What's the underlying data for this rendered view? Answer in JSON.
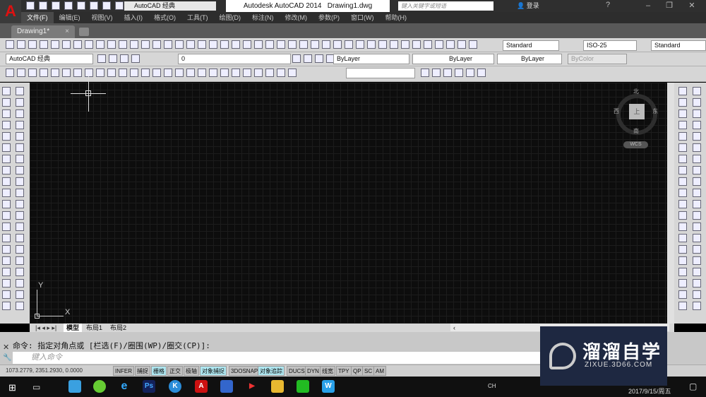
{
  "titlebar": {
    "app_title": "Autodesk AutoCAD 2014",
    "file": "Drawing1.dwg",
    "workspace": "AutoCAD 经典",
    "search_placeholder": "键入关键字或短语",
    "login": "登录"
  },
  "menu": [
    "文件(F)",
    "编辑(E)",
    "视图(V)",
    "插入(I)",
    "格式(O)",
    "工具(T)",
    "绘图(D)",
    "标注(N)",
    "修改(M)",
    "参数(P)",
    "窗口(W)",
    "帮助(H)"
  ],
  "doc_tab": {
    "label": "Drawing1*",
    "close": "×"
  },
  "styles": {
    "text_style": "Standard",
    "dim_style": "ISO-25",
    "table_style": "Standard"
  },
  "layers": {
    "workspace": "AutoCAD 经典",
    "layer": "0",
    "color": "ByLayer",
    "linetype": "ByLayer",
    "lineweight": "ByLayer",
    "plotstyle": "ByColor"
  },
  "viewcube": {
    "north": "北",
    "south": "南",
    "east": "东",
    "west": "西",
    "top": "上",
    "wcs": "WCS"
  },
  "ucs": {
    "x": "X",
    "y": "Y"
  },
  "layout_tabs": [
    "模型",
    "布局1",
    "布局2"
  ],
  "command": {
    "history": "命令: 指定对角点或 [栏选(F)/圈围(WP)/圈交(CP)]:",
    "placeholder": "键入命令"
  },
  "status": {
    "coords": "1073.2779, 2351.2930, 0.0000",
    "toggles": [
      {
        "label": "INFER",
        "on": false
      },
      {
        "label": "捕捉",
        "on": false
      },
      {
        "label": "栅格",
        "on": true
      },
      {
        "label": "正交",
        "on": false
      },
      {
        "label": "极轴",
        "on": false
      },
      {
        "label": "对象捕捉",
        "on": true
      },
      {
        "label": "3DOSNAP",
        "on": false
      },
      {
        "label": "对象追踪",
        "on": true
      },
      {
        "label": "DUCS",
        "on": false
      },
      {
        "label": "DYN",
        "on": false
      },
      {
        "label": "线宽",
        "on": false
      },
      {
        "label": "TPY",
        "on": false
      },
      {
        "label": "QP",
        "on": false
      },
      {
        "label": "SC",
        "on": false
      },
      {
        "label": "AM",
        "on": false
      }
    ]
  },
  "taskbar": {
    "ime": "CH",
    "clock": "2017/9/15/周五"
  },
  "watermark": {
    "title": "溜溜自学",
    "url": "ZIXUE.3D66.COM"
  },
  "colors": {
    "accent": "#aee6f0",
    "canvas": "#0d0d0d",
    "logo": "#dd1111"
  }
}
